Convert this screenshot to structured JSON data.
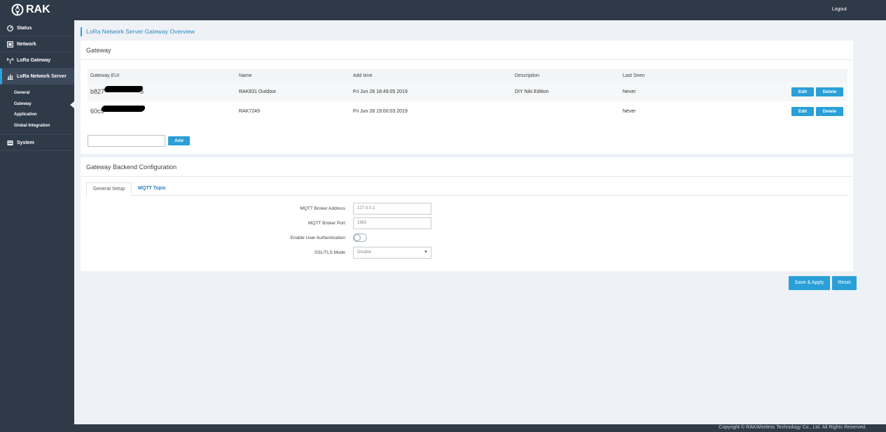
{
  "header": {
    "brand": "RAK",
    "logout_label": "Logout"
  },
  "sidebar": {
    "items": [
      {
        "label": "Status",
        "icon": "status-icon"
      },
      {
        "label": "Network",
        "icon": "network-icon"
      },
      {
        "label": "LoRa Gateway",
        "icon": "antenna-icon"
      },
      {
        "label": "LoRa Network Server",
        "icon": "bar-chart-icon",
        "active": true
      },
      {
        "label": "System",
        "icon": "system-icon"
      }
    ],
    "subitems": [
      "General",
      "Gateway",
      "Application",
      "Global Integration"
    ],
    "current_subitem": "Gateway"
  },
  "breadcrumb": "LoRa Network Server Gateway Overview",
  "gateway_card": {
    "title": "Gateway",
    "columns": [
      "Gateway EUI",
      "Name",
      "Add time",
      "Description",
      "Last Seen"
    ],
    "rows": [
      {
        "eui": "b827",
        "eui_end": "5",
        "name": "RAK831 Outdoor",
        "add_time": "Fri Jun 28 18:49:05 2019",
        "description": "DIY Niki Edition",
        "last_seen": "Never"
      },
      {
        "eui": "60c5",
        "eui_end": "",
        "name": "RAK7249",
        "add_time": "Fri Jun 28 19:00:03 2019",
        "description": "",
        "last_seen": "Never"
      }
    ],
    "edit_label": "Edit",
    "delete_label": "Delete",
    "add_input_value": "",
    "add_label": "Add"
  },
  "backend_card": {
    "title": "Gateway Backend Configuration",
    "tabs": [
      "General Setup",
      "MQTT Topic"
    ],
    "active_tab": "General Setup",
    "fields": {
      "broker_address_label": "MQTT Broker Address",
      "broker_address_value": "127.0.0.1",
      "broker_port_label": "MQTT Broker Port",
      "broker_port_value": "1883",
      "auth_label": "Enable User Authentication",
      "auth_enabled": false,
      "ssl_label": "SSL/TLS Mode",
      "ssl_value": "Disable"
    }
  },
  "actions": {
    "save_label": "Save & Apply",
    "reset_label": "Reset"
  },
  "footer": {
    "copyright": "Copyright © RAKWireless Technology Co., Ltd. All Rights Reserved."
  },
  "colors": {
    "sidebar_bg": "#2e3a48",
    "accent": "#2a9fd8",
    "page_bg": "#eef1f5"
  }
}
